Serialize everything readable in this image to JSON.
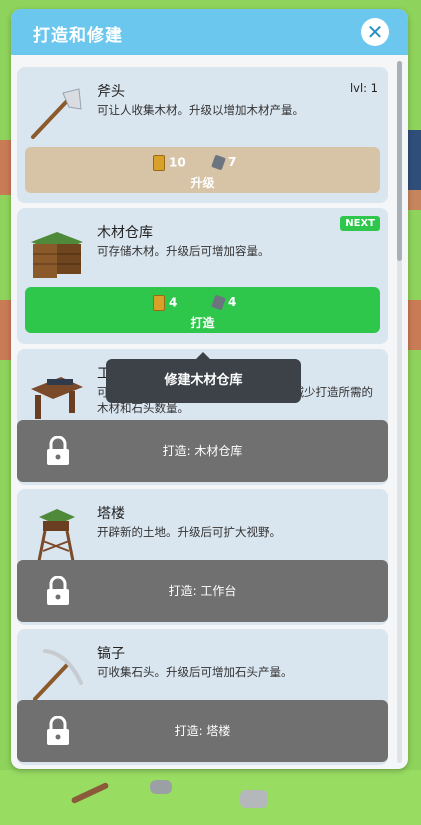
{
  "dialog": {
    "title": "打造和修建",
    "close_icon": "close-icon"
  },
  "items": [
    {
      "name": "斧头",
      "desc": "可让人收集木材。升级以增加木材产量。",
      "level": "lvl: 1",
      "cost_wood": "10",
      "cost_stone": "7",
      "action": "升级",
      "action_color": "#d7c4a7"
    },
    {
      "name": "木材仓库",
      "desc": "可存储木材。升级后可增加容量。",
      "badge": "NEXT",
      "cost_wood": "4",
      "cost_stone": "4",
      "action": "打造",
      "action_color": "#2ec64b"
    },
    {
      "name": "工作台",
      "desc": "可让你打造工具和修建建筑。升级后可减少打造所需的木材和石头数量。",
      "locked_label": "打造: 木材仓库"
    },
    {
      "name": "塔楼",
      "desc": "开辟新的土地。升级后可扩大视野。",
      "locked_label": "打造: 工作台"
    },
    {
      "name": "镐子",
      "desc": "可收集石头。升级后可增加石头产量。",
      "locked_label": "打造: 塔楼"
    }
  ],
  "tooltip": "修建木材仓库",
  "colors": {
    "header": "#6cc7ef",
    "card": "#d9e5ef",
    "locked": "#707070",
    "green": "#2ec64b"
  }
}
